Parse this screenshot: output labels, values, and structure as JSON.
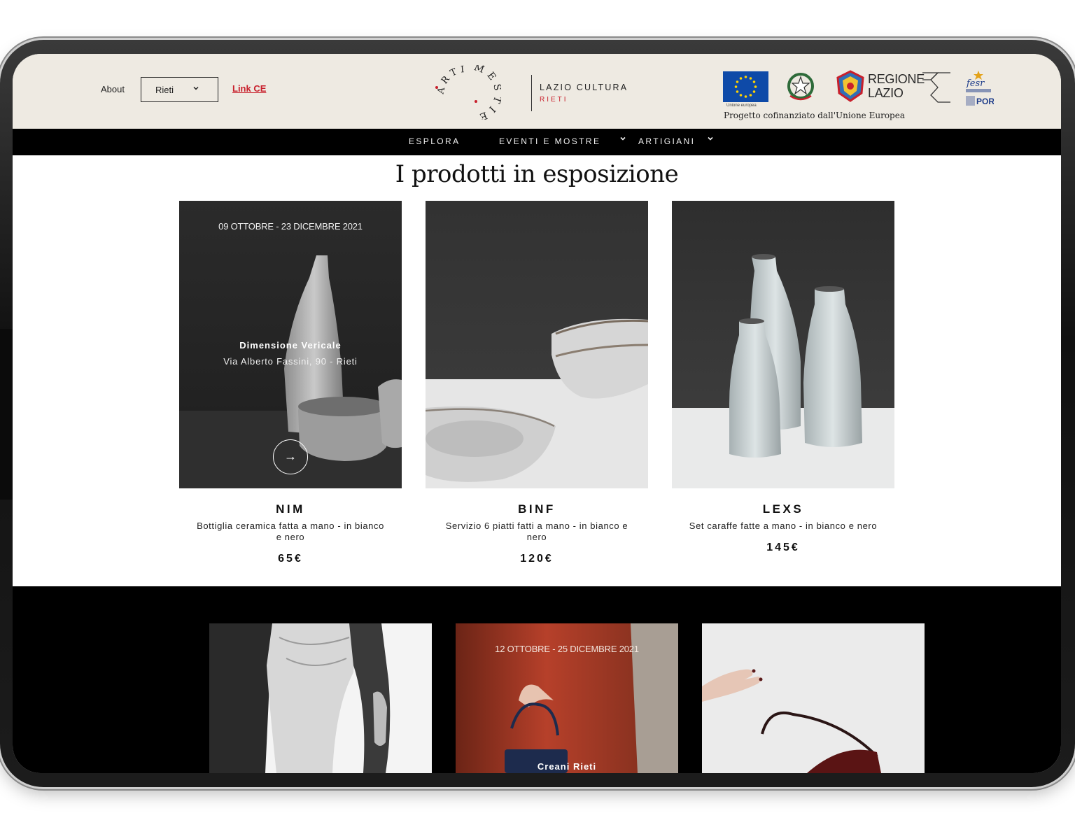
{
  "header": {
    "about_label": "About",
    "city_select_value": "Rieti",
    "link_ce_label": "Link CE",
    "logo_text_top": "MESTIERI",
    "logo_text_left": "ARTI",
    "brand_name": "LAZIO CULTURA",
    "brand_city": "RIETI",
    "eu_caption": "Unione europea",
    "regione_line1": "REGIONE",
    "regione_line2": "LAZIO",
    "cofinanced_text": "Progetto  cofinanziato dall'Unione Europea"
  },
  "nav": {
    "items": [
      {
        "label": "ESPLORA"
      },
      {
        "label": "EVENTI E MOSTRE"
      },
      {
        "label": "ARTIGIANI"
      }
    ]
  },
  "products": {
    "title": "I prodotti in esposizione",
    "items": [
      {
        "name": "NIM",
        "description": "Bottiglia ceramica fatta a mano - in bianco e nero",
        "price": "65€",
        "overlay_date": "09 OTTOBRE - 23 DICEMBRE 2021",
        "overlay_name": "Dimensione Vericale",
        "overlay_address": "Via Alberto Fassini, 90 - Rieti",
        "arrow": "→"
      },
      {
        "name": "BINF",
        "description": "Servizio 6 piatti fatti a mano - in bianco e nero",
        "price": "120€"
      },
      {
        "name": "LEXS",
        "description": "Set caraffe fatte a mano - in bianco e nero",
        "price": "145€"
      }
    ]
  },
  "artisans": {
    "items": [
      {},
      {
        "overlay_date": "12 OTTOBRE - 25 DICEMBRE 2021",
        "overlay_name": "Creani Rieti"
      },
      {}
    ]
  },
  "icons": {
    "select": "chevron-down-icon",
    "arrow": "arrow-right-icon",
    "eu": "eu-flag-icon",
    "emblem": "italian-emblem-icon"
  },
  "colors": {
    "header_bg": "#eeeae2",
    "accent_red": "#c8202c",
    "nav_bg": "#000000",
    "eu_blue": "#0e4aa8"
  }
}
